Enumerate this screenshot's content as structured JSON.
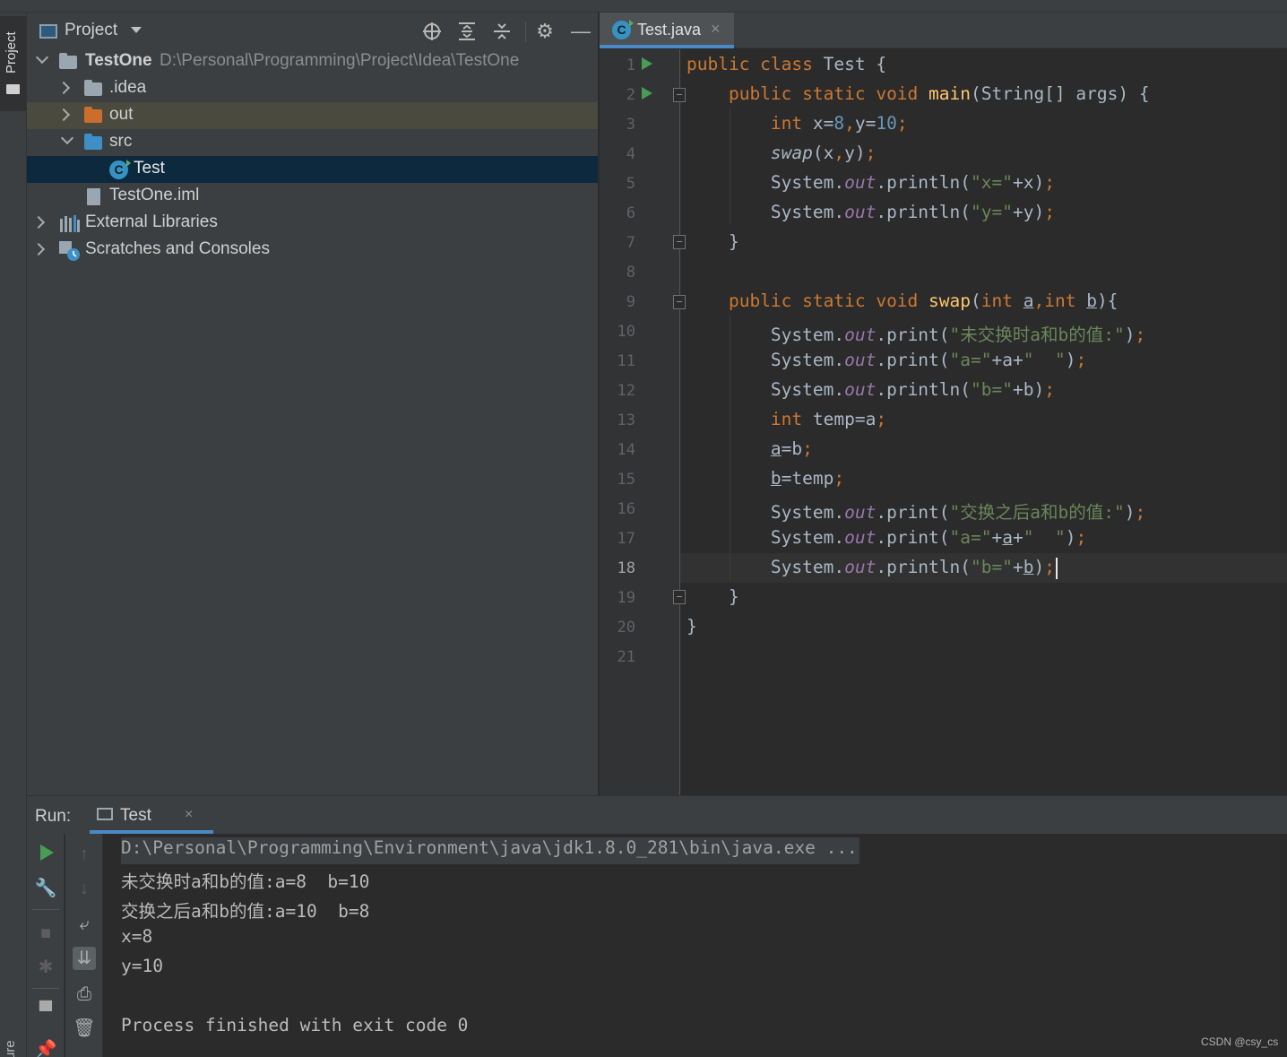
{
  "project_panel": {
    "title": "Project",
    "header_icons": [
      "locate-icon",
      "expand-all-icon",
      "collapse-all-icon",
      "gear-icon",
      "minimize-icon"
    ],
    "tree": [
      {
        "name": "TestOne",
        "path": "D:\\Personal\\Programming\\Project\\Idea\\TestOne",
        "icon": "module-folder-icon",
        "expanded": true
      },
      {
        "name": ".idea",
        "icon": "folder-icon",
        "expanded": false
      },
      {
        "name": "out",
        "icon": "folder-orange-icon",
        "expanded": false
      },
      {
        "name": "src",
        "icon": "source-folder-icon",
        "expanded": true
      },
      {
        "name": "Test",
        "icon": "java-class-icon",
        "selected": true
      },
      {
        "name": "TestOne.iml",
        "icon": "iml-file-icon"
      },
      {
        "name": "External Libraries",
        "icon": "libraries-icon",
        "expanded": false
      },
      {
        "name": "Scratches and Consoles",
        "icon": "scratches-icon",
        "expanded": false
      }
    ]
  },
  "left_stripe": {
    "project_label": "Project",
    "structure_label": "ure"
  },
  "editor": {
    "tab": {
      "name": "Test.java",
      "close": "×"
    },
    "current_line": 18,
    "line_numbers": [
      "1",
      "2",
      "3",
      "4",
      "5",
      "6",
      "7",
      "8",
      "9",
      "10",
      "11",
      "12",
      "13",
      "14",
      "15",
      "16",
      "17",
      "18",
      "19",
      "20",
      "21"
    ],
    "code": {
      "l1": [
        "public class ",
        "Test {"
      ],
      "l2": [
        "public static void ",
        "main",
        "(String[] args) {"
      ],
      "l3": [
        "int ",
        "x=",
        "8",
        ",",
        "y=",
        "10",
        ";"
      ],
      "l4": [
        "swap",
        "(x",
        ",",
        "y)",
        ";"
      ],
      "l5": [
        "System.",
        "out",
        ".println(",
        "\"x=\"",
        "+x)",
        ";"
      ],
      "l6": [
        "System.",
        "out",
        ".println(",
        "\"y=\"",
        "+y)",
        ";"
      ],
      "l7": [
        "}"
      ],
      "l9": [
        "public static void ",
        "swap",
        "(",
        "int ",
        "a",
        ",",
        "int ",
        "b",
        "){"
      ],
      "l10": [
        "System.",
        "out",
        ".print(",
        "\"未交换时a和b的值:\"",
        ")",
        ";"
      ],
      "l11": [
        "System.",
        "out",
        ".print(",
        "\"a=\"",
        "+a+",
        "\"  \"",
        ")",
        ";"
      ],
      "l12": [
        "System.",
        "out",
        ".println(",
        "\"b=\"",
        "+b)",
        ";"
      ],
      "l13": [
        "int ",
        "temp=a",
        ";"
      ],
      "l14": [
        "a",
        "=b",
        ";"
      ],
      "l15": [
        "b",
        "=temp",
        ";"
      ],
      "l16": [
        "System.",
        "out",
        ".print(",
        "\"交换之后a和b的值:\"",
        ")",
        ";"
      ],
      "l17": [
        "System.",
        "out",
        ".print(",
        "\"a=\"",
        "+",
        "a",
        "+",
        "\"  \"",
        ")",
        ";"
      ],
      "l18": [
        "System.",
        "out",
        ".println(",
        "\"b=\"",
        "+",
        "b",
        ")",
        ";"
      ],
      "l19": [
        "}"
      ],
      "l20": [
        "}"
      ]
    }
  },
  "run_panel": {
    "label": "Run:",
    "tab": {
      "name": "Test",
      "close": "×"
    },
    "toolbar_left": [
      "rerun-icon",
      "wrench-icon",
      "stop-icon",
      "debug-icon",
      "layout-icon",
      "pin-icon"
    ],
    "toolbar_right": [
      "up-arrow-icon",
      "down-arrow-icon",
      "soft-wrap-icon",
      "scroll-to-end-icon",
      "print-icon",
      "trash-icon"
    ],
    "console": [
      "D:\\Personal\\Programming\\Environment\\java\\jdk1.8.0_281\\bin\\java.exe ...",
      "未交换时a和b的值:a=8  b=10",
      "交换之后a和b的值:a=10  b=8",
      "x=8",
      "y=10",
      "",
      "Process finished with exit code 0"
    ]
  },
  "watermark": "CSDN @csy_cs",
  "colors": {
    "keyword": "#cc7832",
    "function": "#ffc66d",
    "number": "#6897bb",
    "string": "#6a8759",
    "static_field": "#9876aa",
    "text": "#a9b7c6",
    "selection": "#0d293e",
    "accent": "#4a88c7",
    "run_green": "#499c54"
  }
}
